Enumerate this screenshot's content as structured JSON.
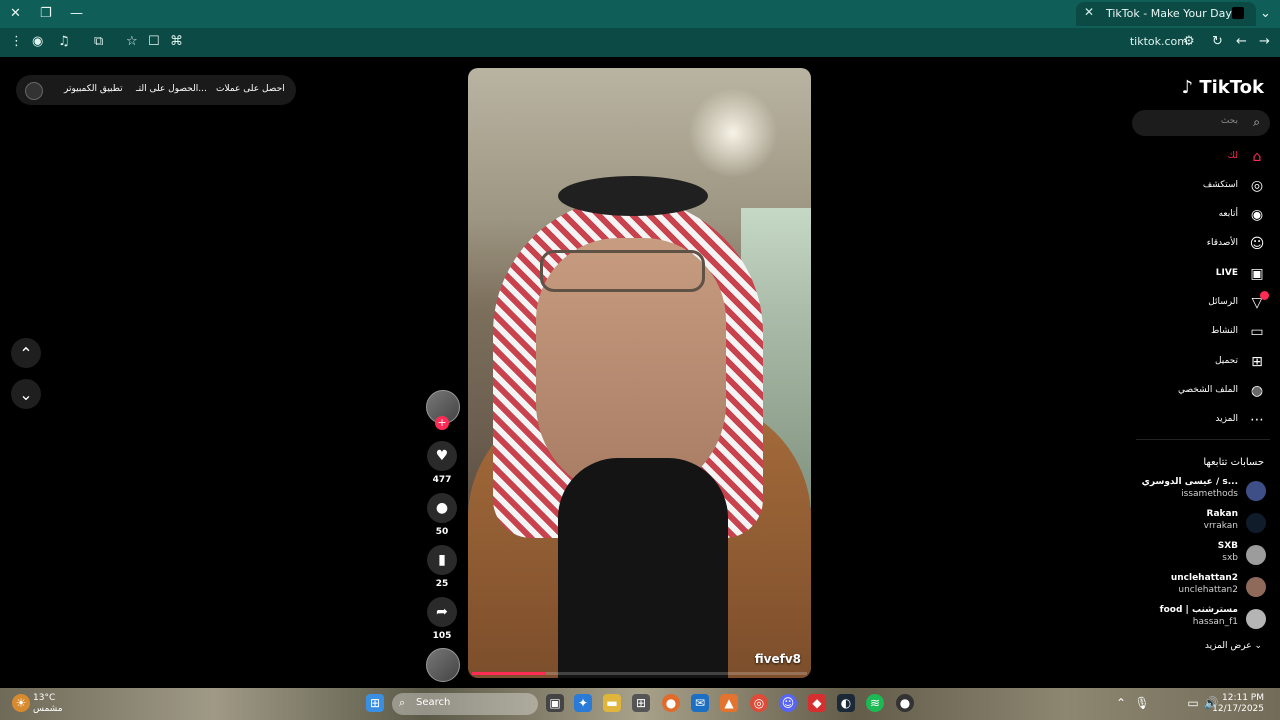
{
  "browser": {
    "tab_title": "TikTok - Make Your Day",
    "url": "tiktok.com"
  },
  "top_pill": {
    "get_coins": "احصل على عملات",
    "get_app": "الحصول على التـ...",
    "computer_app": "تطبيق الكمبيوتر"
  },
  "video": {
    "username": "fivefv8"
  },
  "actions": {
    "likes": "477",
    "comments": "50",
    "saves": "25",
    "shares": "105"
  },
  "sidebar": {
    "logo": "TikTok",
    "search_placeholder": "بحث",
    "nav": [
      {
        "label": "لك"
      },
      {
        "label": "استكشف"
      },
      {
        "label": "أتابعه"
      },
      {
        "label": "الأصدقاء"
      },
      {
        "label": "LIVE"
      },
      {
        "label": "الرسائل"
      },
      {
        "label": "النشاط"
      },
      {
        "label": "تحميل"
      },
      {
        "label": "الملف الشخصي"
      },
      {
        "label": "المزيد"
      }
    ],
    "following_title": "حسابات تتابعها",
    "accounts": [
      {
        "name": "عيسى الدوسري / s...",
        "handle": "issamethods"
      },
      {
        "name": "Rakan",
        "handle": "vrrakan"
      },
      {
        "name": "SXB",
        "handle": "sxb"
      },
      {
        "name": "unclehattan2",
        "handle": "unclehattan2"
      },
      {
        "name": "food | مسترشنب",
        "handle": "hassan_f1"
      }
    ],
    "see_more": "عرض المزيد"
  },
  "taskbar": {
    "weather_temp": "13°C",
    "weather_desc": "مشمس",
    "search_label": "Search",
    "time": "12:11 PM",
    "date": "12/17/2025"
  },
  "colors": {
    "accent": "#fe2c55",
    "chrome_bg": "#0f5e57"
  }
}
